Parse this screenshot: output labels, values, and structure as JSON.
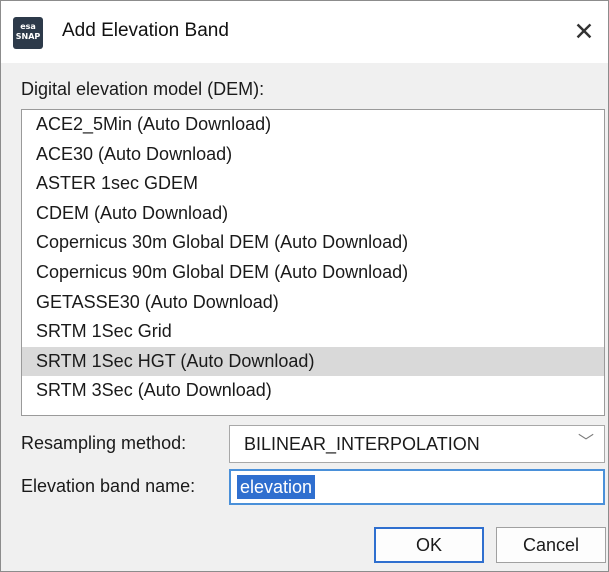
{
  "window": {
    "title": "Add Elevation Band",
    "icon_text": [
      "esa",
      "SNAP"
    ],
    "close_glyph": "✕"
  },
  "dem": {
    "label": "Digital elevation model (DEM):",
    "items": [
      "ACE2_5Min (Auto Download)",
      "ACE30 (Auto Download)",
      "ASTER 1sec GDEM",
      "CDEM (Auto Download)",
      "Copernicus 30m Global DEM (Auto Download)",
      "Copernicus 90m Global DEM (Auto Download)",
      "GETASSE30 (Auto Download)",
      "SRTM 1Sec Grid",
      "SRTM 1Sec HGT (Auto Download)",
      "SRTM 3Sec (Auto Download)"
    ],
    "selected": "SRTM 1Sec HGT (Auto Download)"
  },
  "resampling": {
    "label": "Resampling method:",
    "value": "BILINEAR_INTERPOLATION",
    "chevron": "﹀"
  },
  "band_name": {
    "label": "Elevation band name:",
    "value": "elevation"
  },
  "buttons": {
    "ok": "OK",
    "cancel": "Cancel"
  },
  "colors": {
    "selection_highlight": "#d9d9d9",
    "focus_blue": "#2f6fcf",
    "text_selection": "#2f6fcf"
  }
}
